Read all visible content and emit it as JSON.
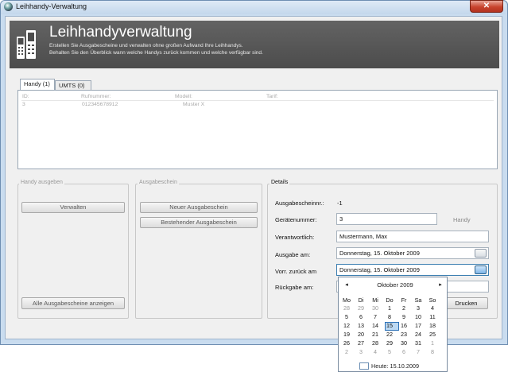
{
  "window": {
    "title": "Leihhandy-Verwaltung",
    "close_glyph": "✕"
  },
  "header": {
    "title": "Leihhandyverwaltung",
    "desc1": "Erstellen Sie Ausgabescheine und verwalten ohne großen Aufwand Ihre Leihhandys.",
    "desc2": "Behalten Sie den Überblick wann welche Handys zurück kommen und welche verfügbar sind."
  },
  "tabs": [
    {
      "label": "Handy (1)"
    },
    {
      "label": "UMTS (0)"
    }
  ],
  "table": {
    "columns": [
      "ID:",
      "Rufnummer:",
      "Modell:",
      "Tarif:"
    ],
    "rows": [
      [
        "3",
        "012345678912",
        "Muster X",
        ""
      ]
    ]
  },
  "handy_ausgeben": {
    "label": "Handy ausgeben",
    "verwalten": "Verwalten",
    "alle": "Alle Ausgabescheine anzeigen"
  },
  "ausgabeschein": {
    "label": "Ausgabeschein",
    "neu": "Neuer Ausgabeschein",
    "bestehend": "Bestehender Ausgabeschein"
  },
  "details": {
    "label": "Details",
    "ausgabescheinnr_label": "Ausgabescheinnr.:",
    "ausgabescheinnr_value": "-1",
    "geraetenummer_label": "Gerätenummer:",
    "geraetenummer_value": "3",
    "geraetenummer_unit": "Handy",
    "verantwortlich_label": "Verantwortlich:",
    "verantwortlich_value": "Mustermann, Max",
    "ausgabe_label": "Ausgabe am:",
    "ausgabe_value": "Donnerstag, 15.  Oktober  2009",
    "zurueck_label": "Vorr. zurück am",
    "zurueck_value": "Donnerstag, 15.  Oktober  2009",
    "rueckgabe_label": "Rückgabe am:",
    "drucken": "Drucken"
  },
  "calendar": {
    "month": "Oktober 2009",
    "prev": "◂",
    "next": "▸",
    "weekdays": [
      "Mo",
      "Di",
      "Mi",
      "Do",
      "Fr",
      "Sa",
      "So"
    ],
    "weeks": [
      [
        "28",
        "29",
        "30",
        "1",
        "2",
        "3",
        "4"
      ],
      [
        "5",
        "6",
        "7",
        "8",
        "9",
        "10",
        "11"
      ],
      [
        "12",
        "13",
        "14",
        "15",
        "16",
        "17",
        "18"
      ],
      [
        "19",
        "20",
        "21",
        "22",
        "23",
        "24",
        "25"
      ],
      [
        "26",
        "27",
        "28",
        "29",
        "30",
        "31",
        "1"
      ],
      [
        "2",
        "3",
        "4",
        "5",
        "6",
        "7",
        "8"
      ]
    ],
    "today": "Heute: 15.10.2009"
  }
}
